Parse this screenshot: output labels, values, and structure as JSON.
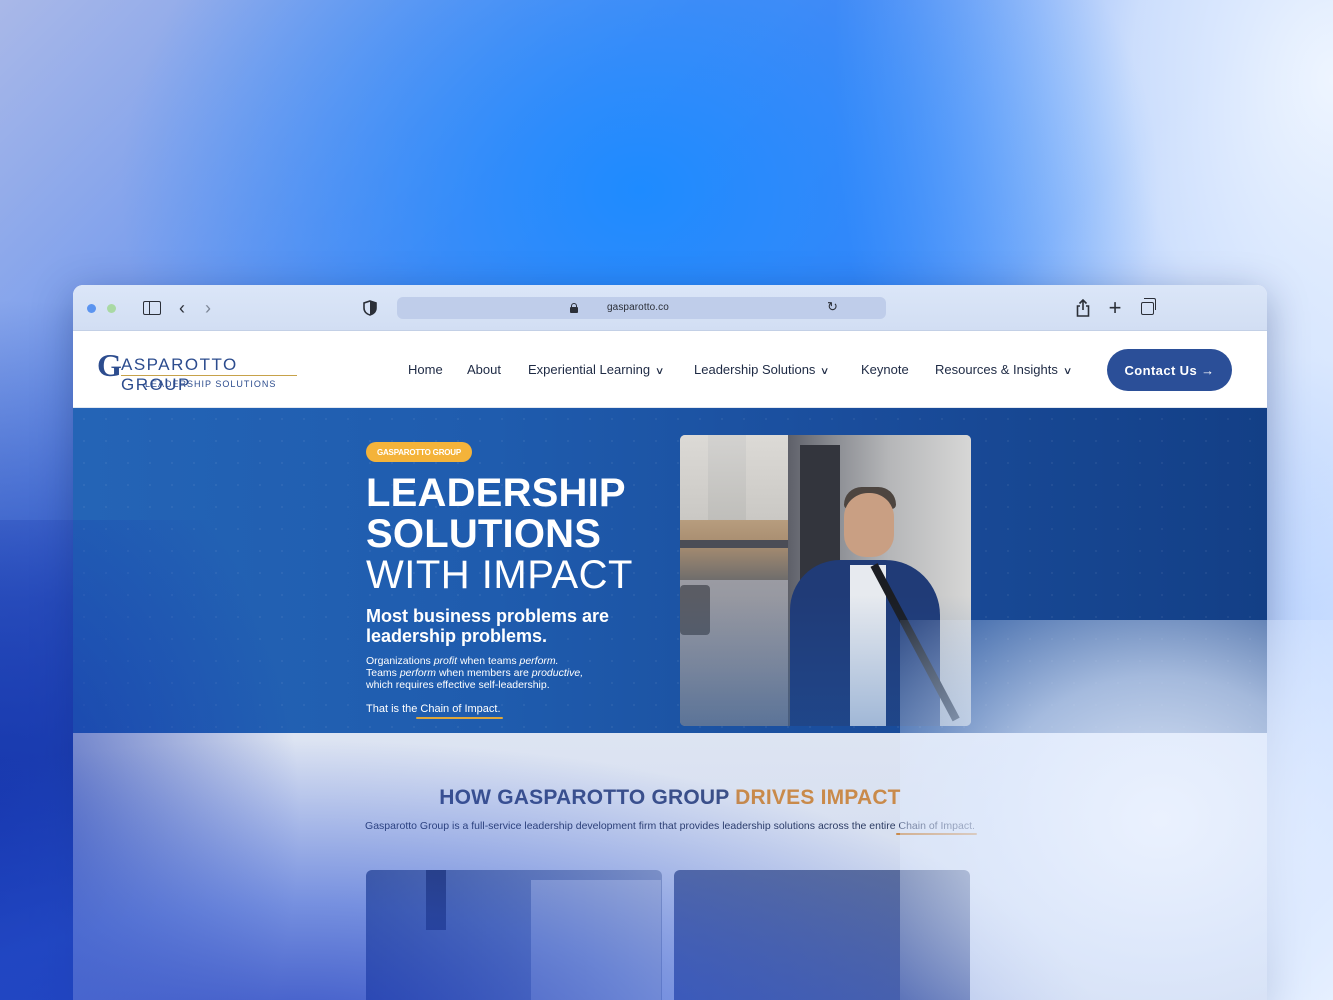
{
  "browser": {
    "url": "gasparotto.co"
  },
  "site": {
    "logo": {
      "initial": "G",
      "name": "ASPAROTTO GROUP",
      "tagline": "LEADERSHIP SOLUTIONS"
    },
    "nav": [
      {
        "label": "Home",
        "has_dropdown": false
      },
      {
        "label": "About",
        "has_dropdown": false
      },
      {
        "label": "Experiential Learning",
        "has_dropdown": true
      },
      {
        "label": "Leadership Solutions",
        "has_dropdown": true
      },
      {
        "label": "Keynote",
        "has_dropdown": false
      },
      {
        "label": "Resources & Insights",
        "has_dropdown": true
      }
    ],
    "contact_button": "Contact Us →"
  },
  "hero": {
    "badge": "GASPAROTTO GROUP",
    "title_line1": "LEADERSHIP",
    "title_line2": "SOLUTIONS",
    "title_line3": "WITH IMPACT",
    "subtitle": "Most business problems are leadership problems.",
    "body": {
      "p1_a": "Organizations ",
      "p1_em1": "profit",
      "p1_b": " when teams ",
      "p1_em2": "perform.",
      "p2_a": "Teams ",
      "p2_em1": "perform",
      "p2_b": " when members are ",
      "p2_em2": "productive,",
      "p3": "which requires effective self-leadership."
    },
    "chain_prefix": "That is the ",
    "chain_link": "Chain of Impact."
  },
  "section2": {
    "title_main": "HOW GASPAROTTO GROUP ",
    "title_accent": "DRIVES IMPACT",
    "desc_a": "Gasparotto Group is a full-service leadership development firm that provides leadership solutions across the entire ",
    "desc_link": "Chain of Impact."
  },
  "colors": {
    "brand_navy": "#2b4f98",
    "badge_orange": "#f4b33a",
    "accent_copper": "#c98a4a",
    "hero_blue": "#1f5cae"
  }
}
